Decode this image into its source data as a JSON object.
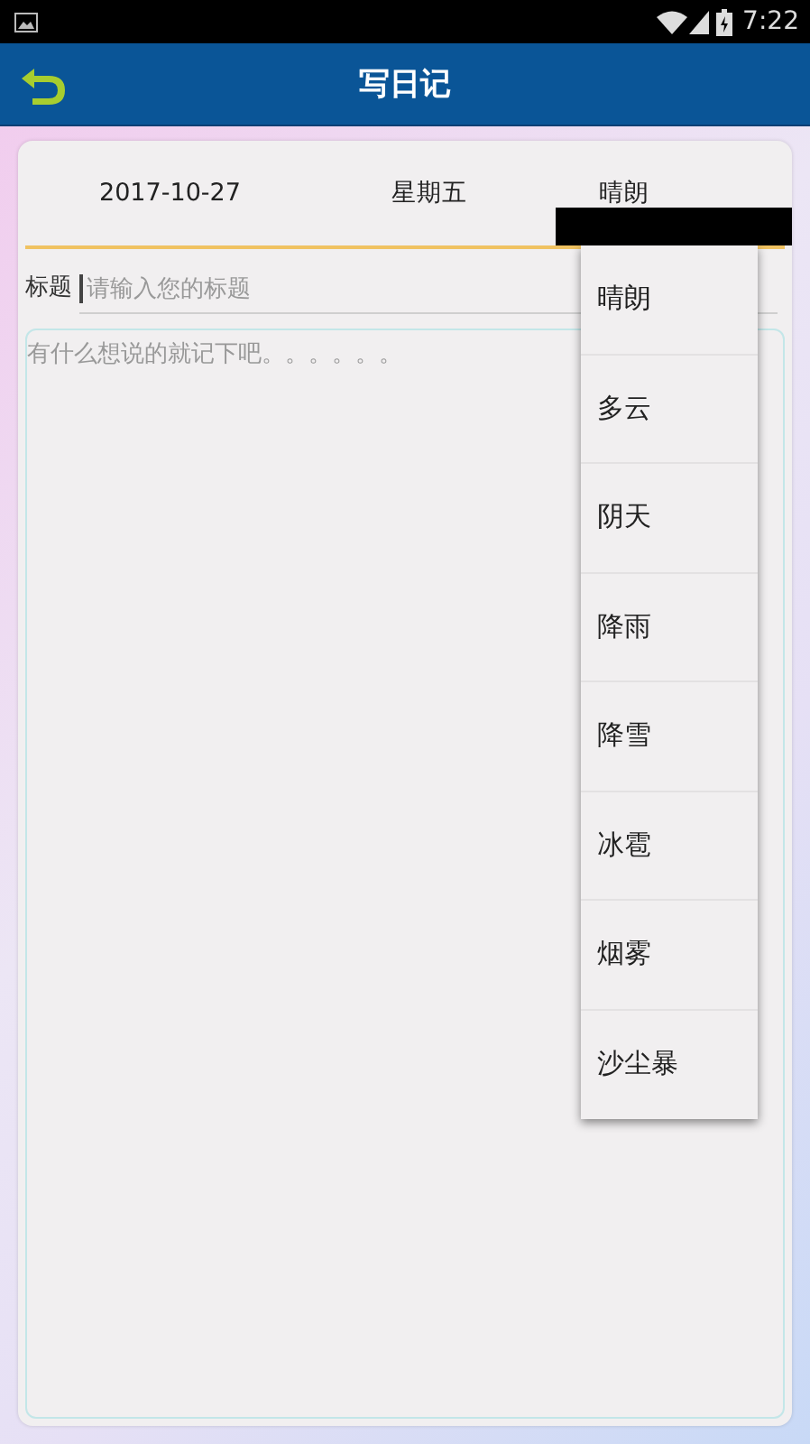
{
  "status_bar": {
    "time": "7:22"
  },
  "app_bar": {
    "title": "写日记"
  },
  "diary": {
    "date": "2017-10-27",
    "weekday": "星期五",
    "weather": "晴朗",
    "title_label": "标题",
    "title_field": {
      "placeholder": "请输入您的标题"
    },
    "content_field": {
      "placeholder": "有什么想说的就记下吧。。。。。。"
    }
  },
  "weather_menu": {
    "items": [
      {
        "label": "晴朗"
      },
      {
        "label": "多云"
      },
      {
        "label": "阴天"
      },
      {
        "label": "降雨"
      },
      {
        "label": "降雪"
      },
      {
        "label": "冰雹"
      },
      {
        "label": "烟雾"
      },
      {
        "label": "沙尘暴"
      }
    ]
  }
}
